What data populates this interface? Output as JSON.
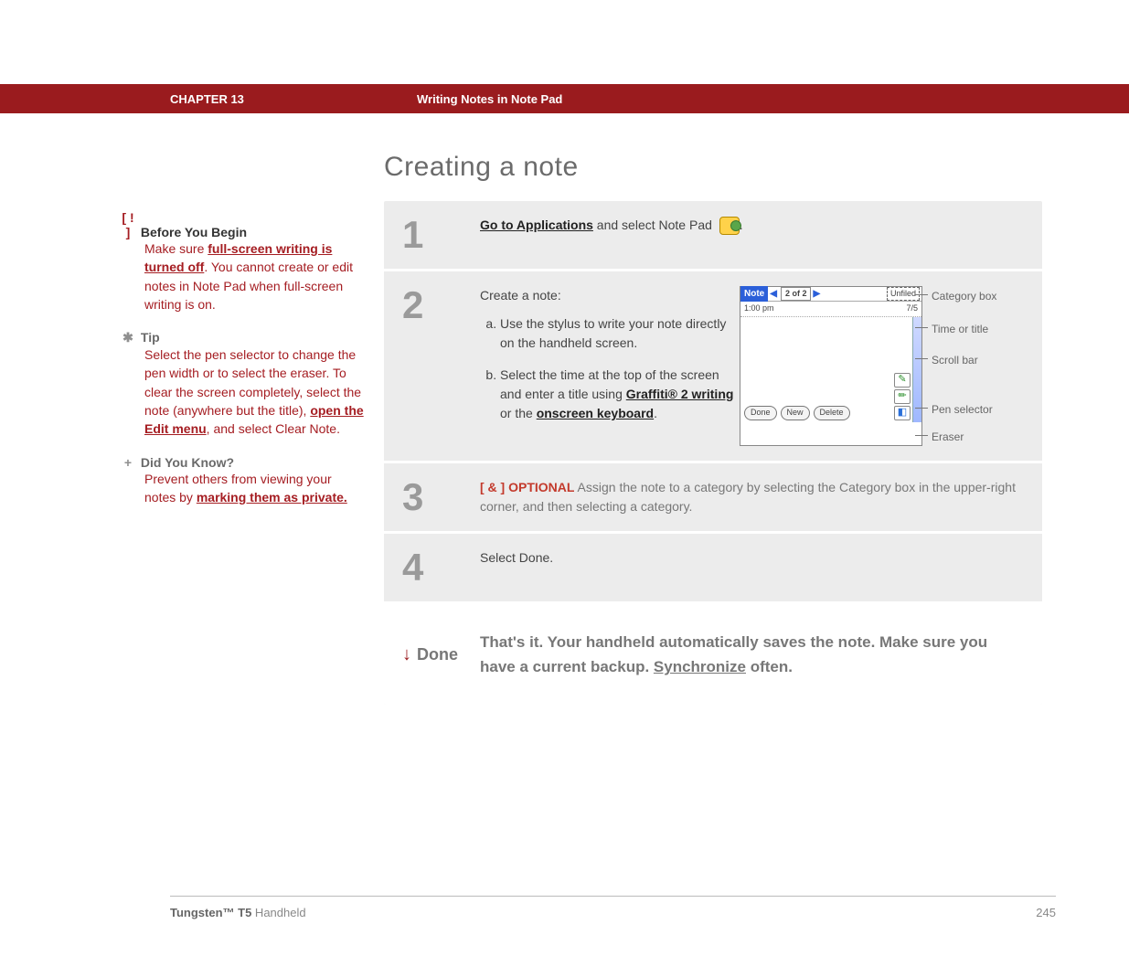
{
  "header": {
    "chapter": "CHAPTER 13",
    "subtitle": "Writing Notes in Note Pad"
  },
  "title": "Creating a note",
  "sidebar": {
    "before": {
      "pre": "[ ! ]",
      "title": "Before You Begin",
      "link": "full-screen writing is turned off",
      "body_pre": "Make sure ",
      "body_post": ". You cannot create or edit notes in Note Pad when full-screen writing is on."
    },
    "tip": {
      "icon": "✱",
      "title": "Tip",
      "body_pre": "Select the pen selector to change the pen width or to select the eraser. To clear the screen completely, select the note (anywhere but the title), ",
      "link": "open the Edit menu",
      "body_post": ", and select Clear Note."
    },
    "dyk": {
      "icon": "+",
      "title": "Did You Know?",
      "body_pre": "Prevent others from viewing your notes by ",
      "link": "marking them as private."
    }
  },
  "steps": {
    "s1_pre": "Go to Applications",
    "s1_post": " and select Note Pad ",
    "s1_end": ".",
    "s2_title": "Create a note:",
    "s2_a": "Use the stylus to write your note directly on the handheld screen.",
    "s2_b_pre": "Select the time at the top of the screen and enter a title using ",
    "s2_b_link1": "Graffiti® 2 writing",
    "s2_b_mid": " or the ",
    "s2_b_link2": "onscreen keyboard",
    "s2_b_post": ".",
    "s3_pre": "[ & ]  OPTIONAL",
    "s3_body": "   Assign the note to a category by selecting the Category box in the upper-right corner, and then selecting a category.",
    "s4": "Select Done.",
    "done_label": "Done",
    "done_body_pre": "That's it. Your handheld automatically saves the note. Make sure you have a current backup. ",
    "done_link": "Synchronize",
    "done_body_post": " often."
  },
  "device": {
    "note": "Note",
    "page": "2 of 2",
    "category": "Unfiled",
    "time": "1:00 pm",
    "count": "7/5",
    "done": "Done",
    "new": "New",
    "delete": "Delete"
  },
  "labels": {
    "category": "Category box",
    "time": "Time or title",
    "scroll": "Scroll bar",
    "pen": "Pen selector",
    "eraser": "Eraser"
  },
  "footer": {
    "product_bold": "Tungsten™ T5",
    "product_rest": " Handheld",
    "page": "245"
  }
}
